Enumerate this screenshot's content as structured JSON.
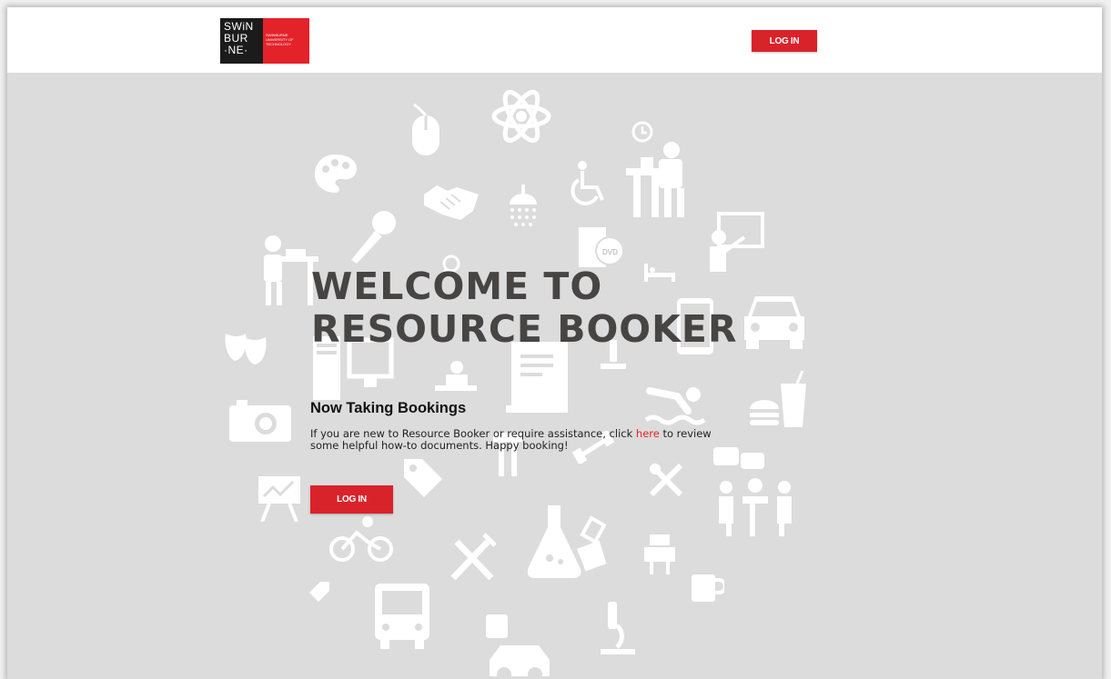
{
  "header": {
    "logo": {
      "line1": "SWiN",
      "line2": "BUR",
      "line3": "·NE·",
      "tagline": "Swinburne University of Technology"
    },
    "login_label": "LOG IN"
  },
  "hero": {
    "title_line1": "WELCOME TO",
    "title_line2": "RESOURCE BOOKER",
    "subheading": "Now Taking Bookings",
    "description_before": "If you are new to Resource Booker or require assistance, click ",
    "link_text": "here",
    "description_after": " to review some helpful how-to documents.  Happy booking!",
    "login_label": "LOG IN"
  },
  "colors": {
    "brand_red": "#d9232b",
    "background": "#dcdcdc",
    "title": "#474444"
  }
}
